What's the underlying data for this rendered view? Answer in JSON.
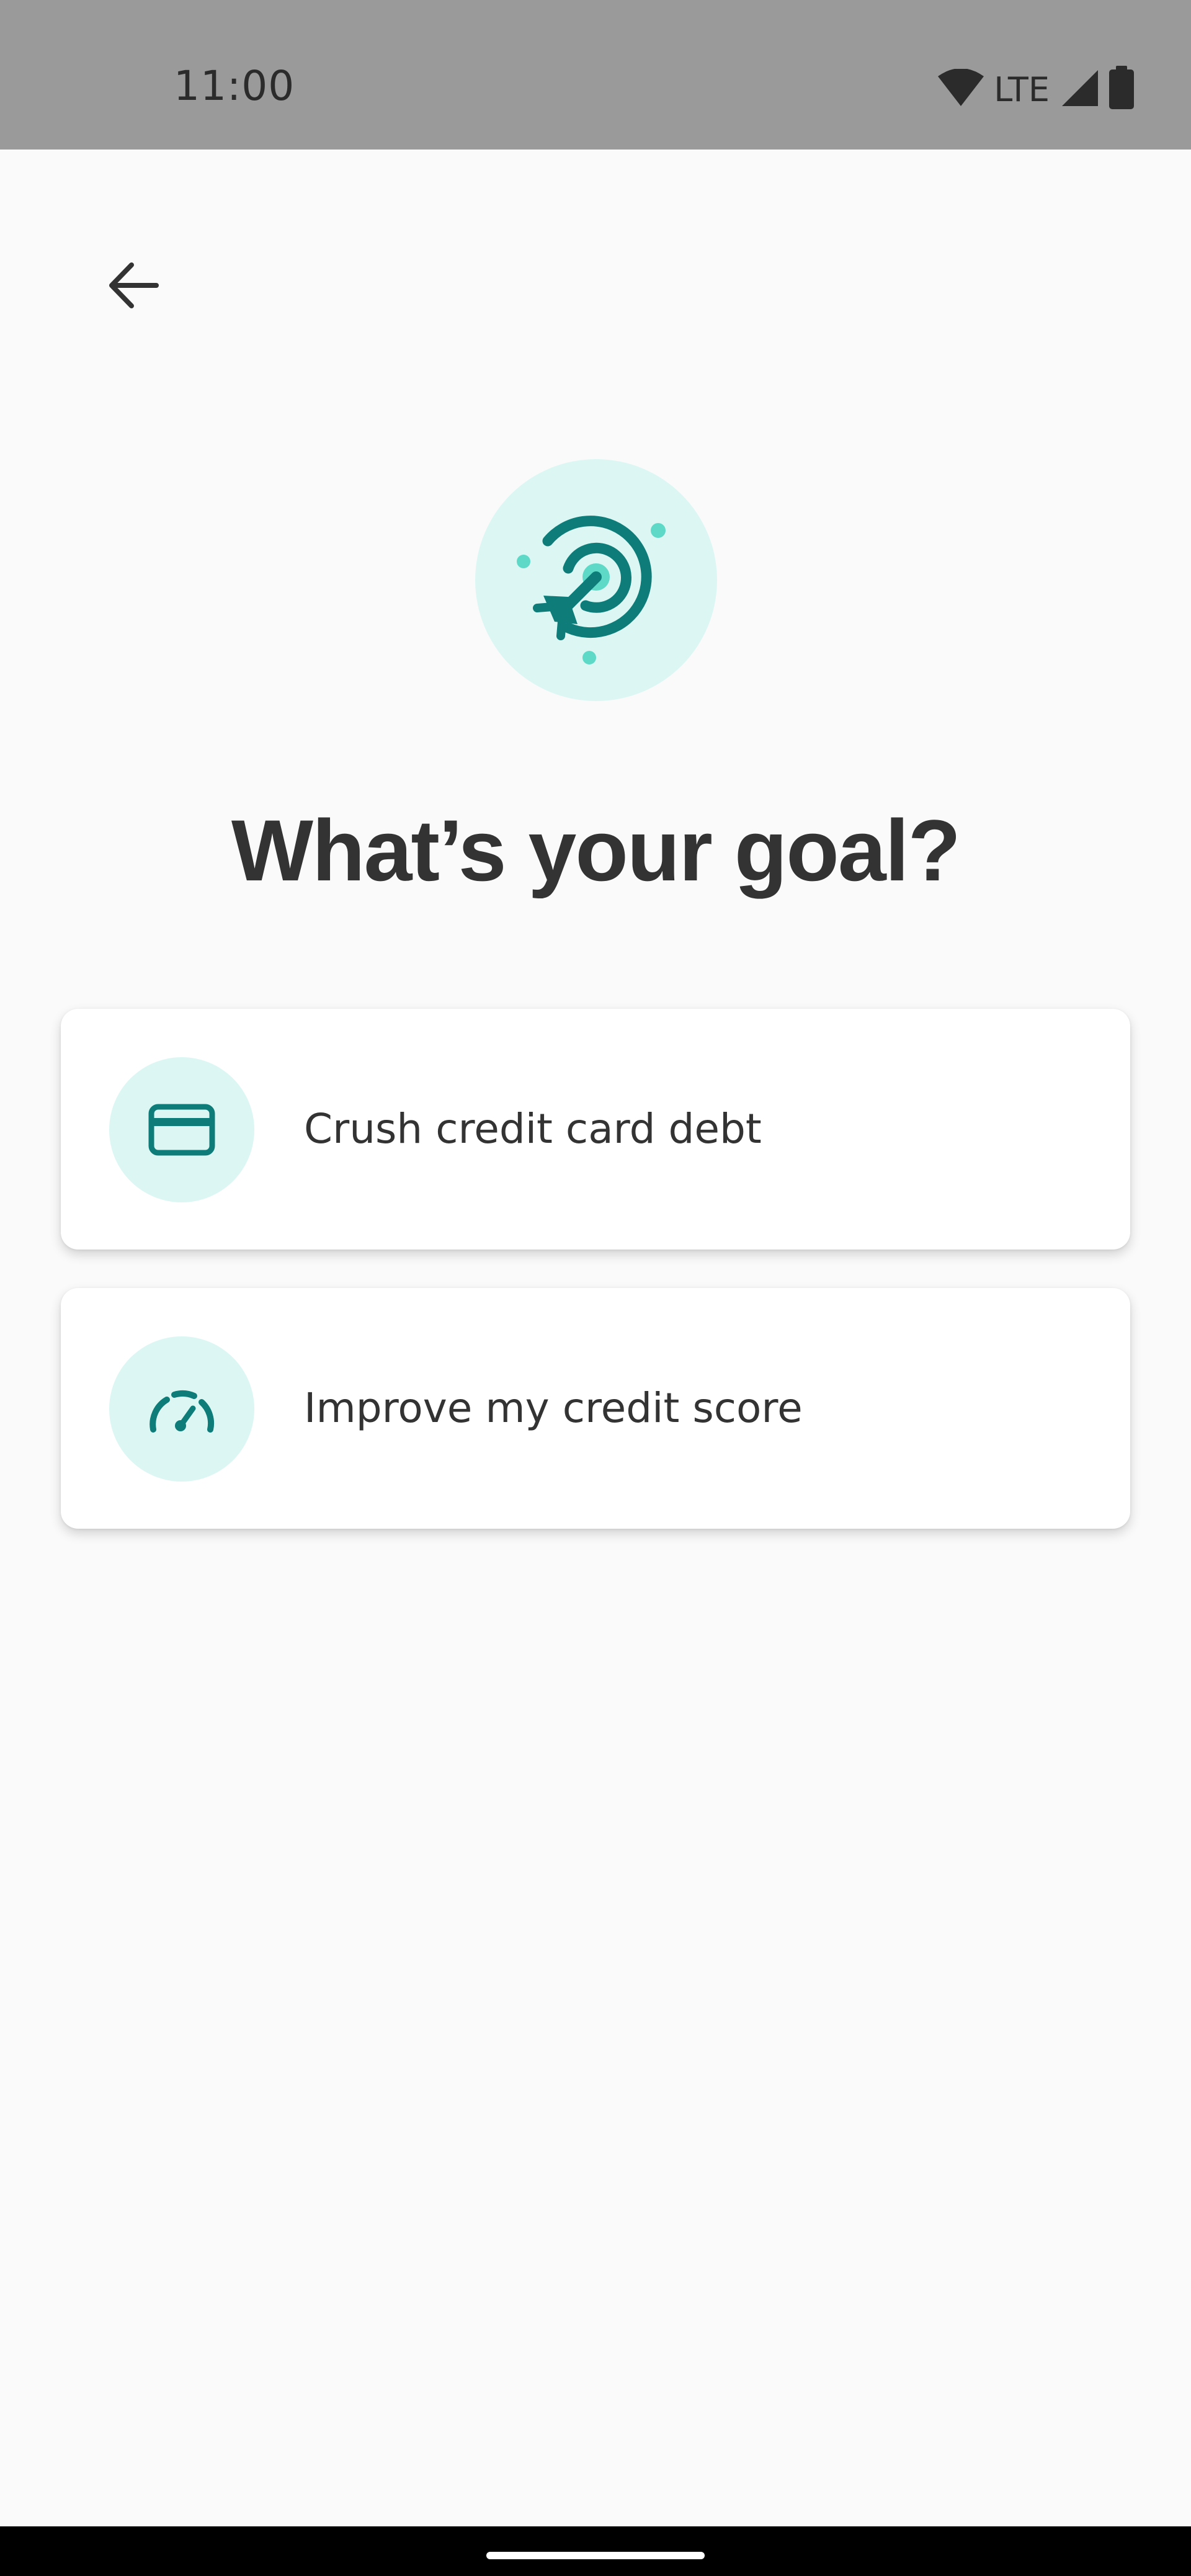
{
  "status_bar": {
    "time": "11:00",
    "network": "LTE",
    "icons": [
      "wifi-icon",
      "signal-icon",
      "battery-icon"
    ]
  },
  "header": {
    "back_icon": "arrow-back-icon"
  },
  "hero": {
    "icon": "target-rocket-icon",
    "title": "What’s your goal?"
  },
  "options": [
    {
      "icon": "credit-card-icon",
      "label": "Crush credit card debt"
    },
    {
      "icon": "speedometer-icon",
      "label": "Improve my credit score"
    }
  ],
  "colors": {
    "accent": "#0e7c79",
    "accent_light": "#5fd9c7",
    "icon_bg": "#dcf7f3",
    "text": "#333333",
    "status_bar": "#9a9a9a",
    "background": "#fafafa"
  }
}
